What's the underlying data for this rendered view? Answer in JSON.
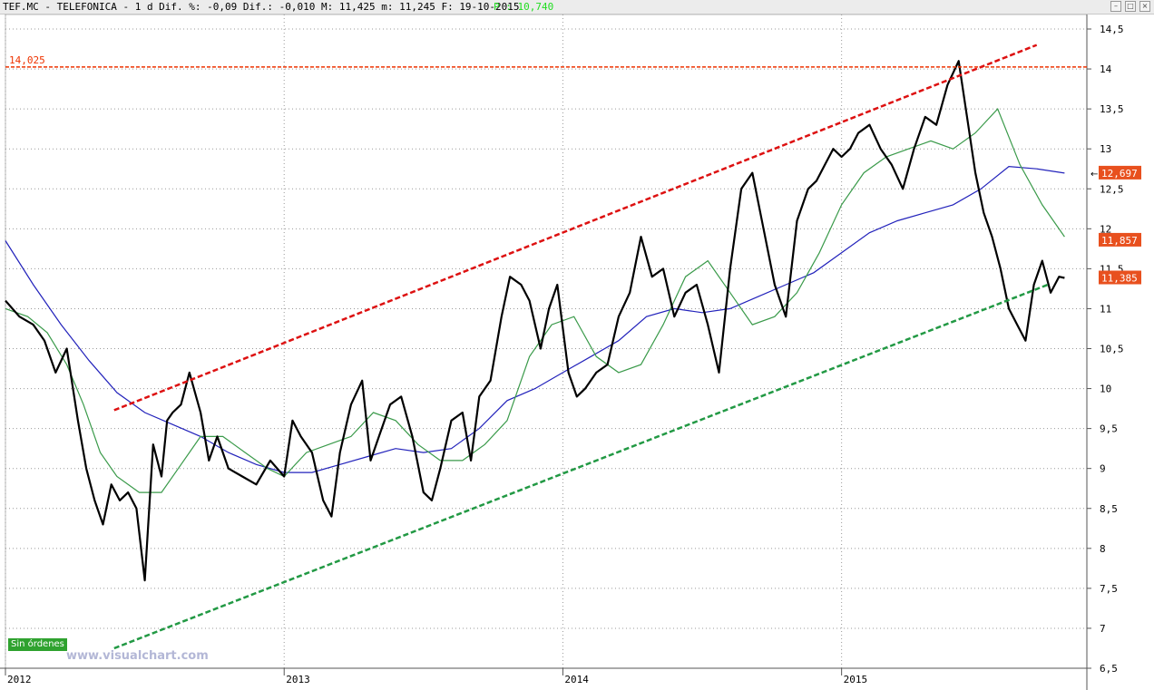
{
  "header": {
    "title": "TEF.MC - TELEFONICA -  1 d Dif. %: -0,09 Dif.: -0,010 M: 11,425 m: 11,245 F: 19-10-2015",
    "price_label": "P : 10,740"
  },
  "badge": "Sin órdenes",
  "watermark": "www.visualchart.com",
  "annotation": "14,025",
  "price_tags": [
    {
      "value": "12,697",
      "color": "#e8501e",
      "arrow": true
    },
    {
      "value": "11,857",
      "color": "#e8501e",
      "arrow": false
    },
    {
      "value": "11,385",
      "color": "#e8501e",
      "arrow": false
    }
  ],
  "colors": {
    "price": "#000000",
    "ma_fast": "#3a9a4a",
    "ma_slow": "#2222bb",
    "resistance": "#dd1111",
    "support": "#229944",
    "level": "#ee3300"
  },
  "chart_data": {
    "type": "line",
    "title": "TEF.MC - TELEFONICA",
    "y_ticks": [
      "6,5",
      "7",
      "7,5",
      "8",
      "8,5",
      "9",
      "9,5",
      "10",
      "10,5",
      "11",
      "11,5",
      "12",
      "12,5",
      "13",
      "13,5",
      "14",
      "14,5"
    ],
    "x_labels": [
      "2012",
      "2013",
      "2014",
      "2015"
    ],
    "ylim": [
      6.5,
      14.5
    ],
    "xlim": [
      2012.0,
      2015.88
    ],
    "grid": true,
    "horizontal_level": 14.025,
    "series": [
      {
        "role": "price",
        "x": [
          2012.0,
          2012.05,
          2012.1,
          2012.14,
          2012.18,
          2012.22,
          2012.26,
          2012.29,
          2012.32,
          2012.35,
          2012.38,
          2012.41,
          2012.44,
          2012.47,
          2012.5,
          2012.53,
          2012.56,
          2012.58,
          2012.6,
          2012.63,
          2012.66,
          2012.7,
          2012.73,
          2012.76,
          2012.8,
          2012.85,
          2012.9,
          2012.95,
          2013.0,
          2013.03,
          2013.06,
          2013.1,
          2013.14,
          2013.17,
          2013.2,
          2013.24,
          2013.28,
          2013.31,
          2013.34,
          2013.38,
          2013.42,
          2013.46,
          2013.5,
          2013.53,
          2013.56,
          2013.6,
          2013.64,
          2013.67,
          2013.7,
          2013.74,
          2013.78,
          2013.81,
          2013.85,
          2013.88,
          2013.92,
          2013.95,
          2013.98,
          2014.02,
          2014.05,
          2014.08,
          2014.12,
          2014.16,
          2014.2,
          2014.24,
          2014.28,
          2014.32,
          2014.36,
          2014.4,
          2014.44,
          2014.48,
          2014.52,
          2014.56,
          2014.6,
          2014.64,
          2014.68,
          2014.72,
          2014.76,
          2014.8,
          2014.84,
          2014.88,
          2014.91,
          2014.94,
          2014.97,
          2015.0,
          2015.03,
          2015.06,
          2015.1,
          2015.14,
          2015.18,
          2015.22,
          2015.26,
          2015.3,
          2015.34,
          2015.38,
          2015.42,
          2015.45,
          2015.48,
          2015.51,
          2015.54,
          2015.57,
          2015.6,
          2015.63,
          2015.66,
          2015.69,
          2015.72,
          2015.75,
          2015.78,
          2015.8
        ],
        "y": [
          11.1,
          10.9,
          10.8,
          10.6,
          10.2,
          10.5,
          9.6,
          9.0,
          8.6,
          8.3,
          8.8,
          8.6,
          8.7,
          8.5,
          7.6,
          9.3,
          8.9,
          9.6,
          9.7,
          9.8,
          10.2,
          9.7,
          9.1,
          9.4,
          9.0,
          8.9,
          8.8,
          9.1,
          8.9,
          9.6,
          9.4,
          9.2,
          8.6,
          8.4,
          9.2,
          9.8,
          10.1,
          9.1,
          9.4,
          9.8,
          9.9,
          9.4,
          8.7,
          8.6,
          9.0,
          9.6,
          9.7,
          9.1,
          9.9,
          10.1,
          10.9,
          11.4,
          11.3,
          11.1,
          10.5,
          11.0,
          11.3,
          10.2,
          9.9,
          10.0,
          10.2,
          10.3,
          10.9,
          11.2,
          11.9,
          11.4,
          11.5,
          10.9,
          11.2,
          11.3,
          10.8,
          10.2,
          11.5,
          12.5,
          12.7,
          12.0,
          11.3,
          10.9,
          12.1,
          12.5,
          12.6,
          12.8,
          13.0,
          12.9,
          13.0,
          13.2,
          13.3,
          13.0,
          12.8,
          12.5,
          13.0,
          13.4,
          13.3,
          13.8,
          14.1,
          13.4,
          12.7,
          12.2,
          11.9,
          11.5,
          11.0,
          10.8,
          10.6,
          11.3,
          11.6,
          11.2,
          11.4,
          11.385
        ]
      },
      {
        "role": "ma_fast",
        "x": [
          2012.0,
          2012.08,
          2012.15,
          2012.22,
          2012.28,
          2012.34,
          2012.4,
          2012.48,
          2012.56,
          2012.62,
          2012.7,
          2012.78,
          2012.86,
          2012.94,
          2013.0,
          2013.08,
          2013.16,
          2013.24,
          2013.32,
          2013.4,
          2013.48,
          2013.56,
          2013.64,
          2013.72,
          2013.8,
          2013.88,
          2013.96,
          2014.04,
          2014.12,
          2014.2,
          2014.28,
          2014.36,
          2014.44,
          2014.52,
          2014.6,
          2014.68,
          2014.76,
          2014.84,
          2014.92,
          2015.0,
          2015.08,
          2015.16,
          2015.24,
          2015.32,
          2015.4,
          2015.48,
          2015.56,
          2015.64,
          2015.72,
          2015.8
        ],
        "y": [
          11.0,
          10.9,
          10.7,
          10.3,
          9.8,
          9.2,
          8.9,
          8.7,
          8.7,
          9.0,
          9.4,
          9.4,
          9.2,
          9.0,
          8.9,
          9.2,
          9.3,
          9.4,
          9.7,
          9.6,
          9.3,
          9.1,
          9.1,
          9.3,
          9.6,
          10.4,
          10.8,
          10.9,
          10.4,
          10.2,
          10.3,
          10.8,
          11.4,
          11.6,
          11.2,
          10.8,
          10.9,
          11.2,
          11.7,
          12.3,
          12.7,
          12.9,
          13.0,
          13.1,
          13.0,
          13.2,
          13.5,
          12.8,
          12.3,
          11.9
        ]
      },
      {
        "role": "ma_slow",
        "x": [
          2012.0,
          2012.1,
          2012.2,
          2012.3,
          2012.4,
          2012.5,
          2012.6,
          2012.7,
          2012.8,
          2012.9,
          2013.0,
          2013.1,
          2013.2,
          2013.3,
          2013.4,
          2013.5,
          2013.6,
          2013.7,
          2013.8,
          2013.9,
          2014.0,
          2014.1,
          2014.2,
          2014.3,
          2014.4,
          2014.5,
          2014.6,
          2014.7,
          2014.8,
          2014.9,
          2015.0,
          2015.1,
          2015.2,
          2015.3,
          2015.4,
          2015.5,
          2015.6,
          2015.7,
          2015.8
        ],
        "y": [
          11.85,
          11.3,
          10.8,
          10.35,
          9.95,
          9.7,
          9.55,
          9.4,
          9.2,
          9.05,
          8.95,
          8.95,
          9.05,
          9.15,
          9.25,
          9.2,
          9.25,
          9.5,
          9.85,
          10.0,
          10.2,
          10.4,
          10.6,
          10.9,
          11.0,
          10.95,
          11.0,
          11.15,
          11.3,
          11.45,
          11.7,
          11.95,
          12.1,
          12.2,
          12.3,
          12.5,
          12.78,
          12.75,
          12.697
        ]
      },
      {
        "role": "resistance",
        "x": [
          2012.39,
          2015.7
        ],
        "y": [
          9.73,
          14.3
        ]
      },
      {
        "role": "support",
        "x": [
          2012.39,
          2015.74
        ],
        "y": [
          6.75,
          11.3
        ]
      }
    ]
  }
}
